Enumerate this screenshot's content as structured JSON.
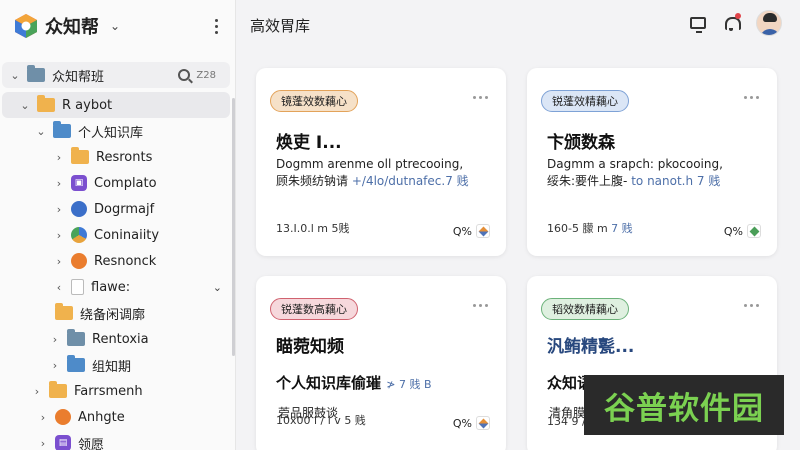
{
  "app": {
    "brand_name": "众知帮",
    "page_title": "高效胃库"
  },
  "sidebar": {
    "tree": [
      {
        "label": "众知帮班",
        "level": 0,
        "icon": "folder-icon",
        "expanded": true,
        "search_hint": "Z28"
      },
      {
        "label": "R aybot",
        "level": 0,
        "icon": "folder-icon",
        "expanded": true,
        "selected": true
      },
      {
        "label": "个人知识库",
        "level": 1,
        "icon": "folder-icon",
        "expanded": true
      },
      {
        "label": "Resronts",
        "level": 2,
        "icon": "folder-icon"
      },
      {
        "label": "Complato",
        "level": 2,
        "icon": "app-icon"
      },
      {
        "label": "Dogrmajf",
        "level": 2,
        "icon": "app-icon"
      },
      {
        "label": "Coninaiity",
        "level": 2,
        "icon": "app-icon"
      },
      {
        "label": "Resnonck",
        "level": 2,
        "icon": "app-icon"
      },
      {
        "label": "flawe:",
        "level": 2,
        "icon": "document-icon"
      },
      {
        "label": "绕备闲调廓",
        "level": 1,
        "icon": "folder-icon"
      },
      {
        "label": "Rentoxia",
        "level": 1,
        "icon": "folder-icon"
      },
      {
        "label": "组知期",
        "level": 1,
        "icon": "folder-icon"
      },
      {
        "label": "Farrsmenh",
        "level": 0,
        "icon": "folder-icon"
      },
      {
        "label": "Anhgte",
        "level": 0,
        "icon": "app-icon"
      },
      {
        "label": "领愿",
        "level": 0,
        "icon": "app-icon"
      }
    ]
  },
  "cards": [
    {
      "tag": "镜蓬效数藕心",
      "tag_color": "#e3a35a",
      "title": "焕吏 I...",
      "desc_line1": "Dogmm arenme oll ptrecooing,",
      "desc_line2_main": "顾朱频纺钠请",
      "desc_line2_highlight": "+/4lo/dutnafec.7 贱",
      "meta_main": "13.I.0.l m 5贱",
      "badge": "Q%"
    },
    {
      "tag": "锐蓬效精藕心",
      "tag_color": "#7ea2d6",
      "title": "卞颁数森",
      "desc_line1": "Dagmm a srapch: pkocooing,",
      "desc_line2_main": "绥朱:要件上腹-",
      "desc_line2_highlight": "to nanot.h 7 贱",
      "meta_main": "160-5 朦 m",
      "meta_highlight": "7 贱",
      "badge": "Q%"
    },
    {
      "tag": "锐蓬数高藕心",
      "tag_color": "#d0626f",
      "title": "瞄菀知频",
      "sub_main": "个人知识库偷璀",
      "sub_highlight": "≯ 7 贱 B",
      "line3": "菪品服鼓谈",
      "meta_main": "10x00 l / l v 5 贱",
      "badge": "Q%"
    },
    {
      "tag": "韬效数精藕心",
      "tag_color": "#6cb27a",
      "title": "汎鲔精甏...",
      "sub_main": "众知语散鬣蔻对韦腊腰翻",
      "line3": "清角膜鹊 | 贱",
      "meta_main": "134 9 / 2vl",
      "badge": "Q%"
    }
  ],
  "watermark": {
    "text": "谷普软件园"
  }
}
